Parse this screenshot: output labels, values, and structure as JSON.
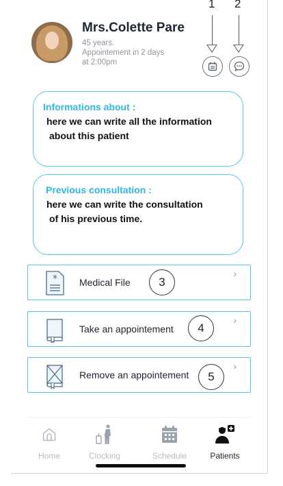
{
  "patient": {
    "name": "Mrs.Colette Pare",
    "age": "45 years.",
    "appointment_line1": "Appointement in 2 days",
    "appointment_line2": "at 2:00pm"
  },
  "markers": {
    "m1": "1",
    "m2": "2",
    "m3": "3",
    "m4": "4",
    "m5": "5"
  },
  "cards": {
    "info_title": "Informations about :",
    "info_line1": "here we can write all the information",
    "info_line2": "about this patient",
    "prev_title": "Previous consultation :",
    "prev_line1": "here we can write the consultation",
    "prev_line2": "of his previous time."
  },
  "actions": [
    {
      "label": "Medical File",
      "icon": "medical-file-icon"
    },
    {
      "label": "Take an appointement",
      "icon": "book-icon"
    },
    {
      "label": "Remove an appointement",
      "icon": "book-crossed-icon"
    }
  ],
  "tabs": [
    {
      "label": "Home",
      "icon": "home-icon"
    },
    {
      "label": "Clocking",
      "icon": "clocking-icon"
    },
    {
      "label": "Schedule",
      "icon": "calendar-icon"
    },
    {
      "label": "Patients",
      "icon": "patients-icon"
    }
  ],
  "colors": {
    "accent": "#55c4e8",
    "title_accent": "#2fb6e4",
    "muted": "#b6bcc4"
  }
}
